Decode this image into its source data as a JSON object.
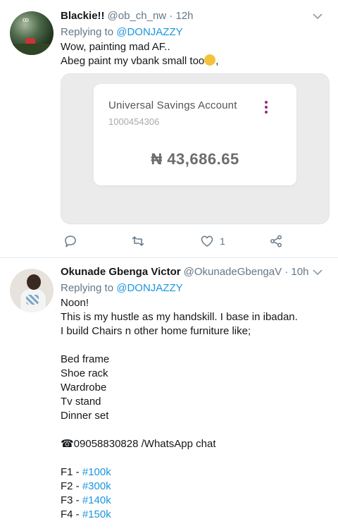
{
  "tweets": [
    {
      "name": "Blackie!!",
      "handle": "@ob_ch_nw · 12h",
      "replying_prefix": "Replying to ",
      "replying_to": "@DONJAZZY",
      "lines": [
        "Wow, painting mad AF..",
        "Abeg paint my vbank small too"
      ],
      "line2_suffix": ",",
      "emoji": "rolling-on-floor-laughing-emoji",
      "media": {
        "account_name": "Universal Savings Account",
        "account_number": "1000454306",
        "balance": "₦ 43,686.65",
        "menu_color": "#a2237b"
      },
      "actions": {
        "reply_count": "",
        "retweet_count": "",
        "like_count": "1"
      }
    },
    {
      "name": "Okunade Gbenga Victor",
      "handle": "@OkunadeGbengaV · 10h",
      "replying_prefix": "Replying to ",
      "replying_to": "@DONJAZZY",
      "lines": [
        "Noon!",
        "This is my hustle as my handskill. I base in ibadan.",
        "I build Chairs n other home furniture like;",
        "",
        "Bed frame",
        "Shoe rack",
        "Wardrobe",
        "Tv stand",
        "Dinner set",
        "",
        "☎09058830828 /WhatsApp chat",
        ""
      ],
      "prices": [
        {
          "label": "F1 - ",
          "tag": "#100k"
        },
        {
          "label": "F2 - ",
          "tag": "#300k"
        },
        {
          "label": "F3 - ",
          "tag": "#140k"
        },
        {
          "label": "F4 - ",
          "tag": "#150k"
        }
      ]
    }
  ],
  "colors": {
    "link": "#1b95e0",
    "muted": "#657786",
    "text": "#14171a"
  }
}
